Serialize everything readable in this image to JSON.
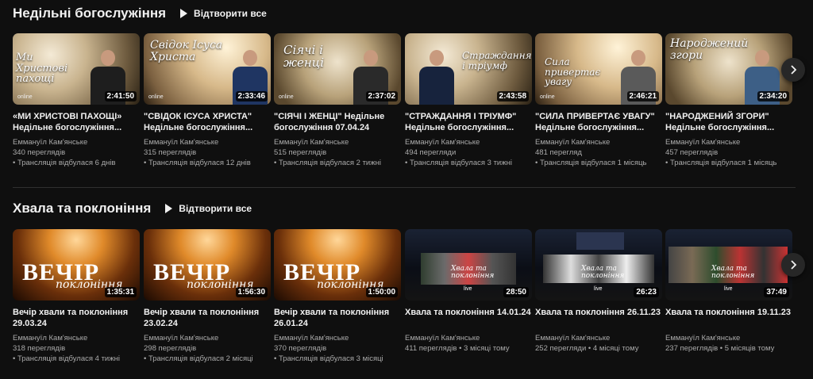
{
  "shelves": [
    {
      "title": "Недільні богослужіння",
      "play_all": "Відтворити все",
      "videos": [
        {
          "thumb_text": "Ми Христові пахощі",
          "thumb_tag": "online",
          "duration": "2:41:50",
          "title": "«МИ ХРИСТОВІ ПАХОЩІ» Недільне богослужіння...",
          "channel": "Еммануїл Кам'янське",
          "views": "340 переглядів",
          "time": "Трансляція відбулася 6 днів"
        },
        {
          "thumb_text": "Свідок Ісуса Христа",
          "thumb_tag": "online",
          "duration": "2:33:46",
          "title": "\"СВІДОК ІСУСА ХРИСТА\" Недільне богослужіння...",
          "channel": "Еммануїл Кам'янське",
          "views": "315 переглядів",
          "time": "Трансляція відбулася 12 днів"
        },
        {
          "thumb_text": "Сіячі і женці",
          "thumb_tag": "online",
          "duration": "2:37:02",
          "title": "\"СІЯЧІ І ЖЕНЦІ\" Недільне богослужіння 07.04.24",
          "channel": "Еммануїл Кам'янське",
          "views": "515 переглядів",
          "time": "Трансляція відбулася 2 тижні"
        },
        {
          "thumb_text": "Страждання і тріумф",
          "thumb_tag": "",
          "duration": "2:43:58",
          "title": "\"СТРАЖДАННЯ І ТРІУМФ\" Недільне богослужіння...",
          "channel": "Еммануїл Кам'янське",
          "views": "494 перегляди",
          "time": "Трансляція відбулася 3 тижні"
        },
        {
          "thumb_text": "Сила привертає увагу",
          "thumb_tag": "online",
          "duration": "2:46:21",
          "title": "\"СИЛА ПРИВЕРТАЄ УВАГУ\" Недільне богослужіння...",
          "channel": "Еммануїл Кам'янське",
          "views": "481 перегляд",
          "time": "Трансляція відбулася 1 місяць"
        },
        {
          "thumb_text": "Народжений згори",
          "thumb_tag": "",
          "duration": "2:34:20",
          "title": "\"НАРОДЖЕНИЙ ЗГОРИ\" Недільне богослужіння...",
          "channel": "Еммануїл Кам'янське",
          "views": "457 переглядів",
          "time": "Трансляція відбулася 1 місяць"
        }
      ]
    },
    {
      "title": "Хвала та поклоніння",
      "play_all": "Відтворити все",
      "videos": [
        {
          "thumb_big": "ВЕЧІР",
          "thumb_script": "поклоніння",
          "duration": "1:35:31",
          "title": "Вечір хвали та поклоніння 29.03.24",
          "channel": "Еммануїл Кам'янське",
          "views": "318 переглядів",
          "time": "Трансляція відбулася 4 тижні"
        },
        {
          "thumb_big": "ВЕЧІР",
          "thumb_script": "поклоніння",
          "duration": "1:56:30",
          "title": "Вечір хвали та поклоніння 23.02.24",
          "channel": "Еммануїл Кам'янське",
          "views": "298 переглядів",
          "time": "Трансляція відбулася 2 місяці"
        },
        {
          "thumb_big": "ВЕЧІР",
          "thumb_script": "поклоніння",
          "duration": "1:50:00",
          "title": "Вечір хвали та поклоніння 26.01.24",
          "channel": "Еммануїл Кам'янське",
          "views": "370 переглядів",
          "time": "Трансляція відбулася 3 місяці"
        },
        {
          "thumb_logo": "Хвала та поклоніння",
          "thumb_live": "live",
          "duration": "28:50",
          "title": "Хвала та поклоніння 14.01.24",
          "channel": "Еммануїл Кам'янське",
          "views": "411 переглядів",
          "time": "3 місяці тому"
        },
        {
          "thumb_logo": "Хвала та поклоніння",
          "thumb_live": "live",
          "duration": "26:23",
          "title": "Хвала та поклоніння 26.11.23",
          "channel": "Еммануїл Кам'янське",
          "views": "252 перегляди",
          "time": "4 місяці тому"
        },
        {
          "thumb_logo": "Хвала та поклоніння",
          "thumb_live": "live",
          "duration": "37:49",
          "title": "Хвала та поклоніння 19.11.23",
          "channel": "Еммануїл Кам'янське",
          "views": "237 переглядів",
          "time": "5 місяців тому"
        }
      ]
    }
  ],
  "icons": {
    "next": "chevron-right-icon",
    "play": "play-icon"
  },
  "colors": {
    "background": "#0f0f0f",
    "text": "#f1f1f1",
    "secondary_text": "#aaaaaa"
  }
}
